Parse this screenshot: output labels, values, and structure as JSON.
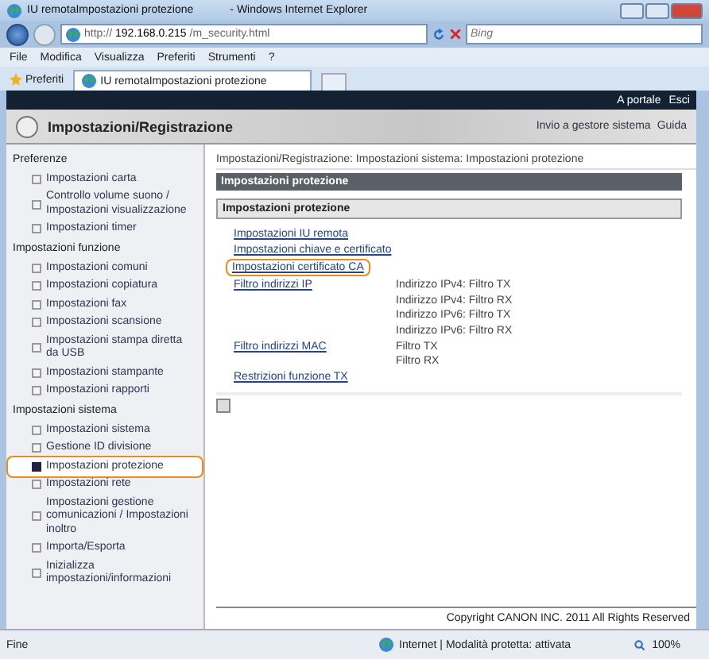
{
  "browser": {
    "title": "IU remotaImpostazioni protezione",
    "title_suffix": "- Windows Internet Explorer",
    "url_scheme": "http://",
    "url_host": "192.168.0.215",
    "url_path": "/m_security.html",
    "search_placeholder": "Bing",
    "menu": [
      "File",
      "Modifica",
      "Visualizza",
      "Preferiti",
      "Strumenti",
      "?"
    ],
    "favorites": "Preferiti",
    "tab": "IU remotaImpostazioni protezione"
  },
  "header": {
    "links": [
      "A portale",
      "Esci"
    ],
    "title": "Impostazioni/Registrazione",
    "nav_links": [
      "Invio a gestore sistema",
      "Guida"
    ]
  },
  "sidebar": [
    {
      "label": "Preferenze",
      "items": [
        {
          "label": "Impostazioni carta",
          "selected": false,
          "highlighted": false
        },
        {
          "label": "Controllo volume suono / Impostazioni visualizzazione",
          "selected": false,
          "highlighted": false
        },
        {
          "label": "Impostazioni timer",
          "selected": false,
          "highlighted": false
        }
      ]
    },
    {
      "label": "Impostazioni funzione",
      "items": [
        {
          "label": "Impostazioni comuni",
          "selected": false,
          "highlighted": false
        },
        {
          "label": "Impostazioni copiatura",
          "selected": false,
          "highlighted": false
        },
        {
          "label": "Impostazioni fax",
          "selected": false,
          "highlighted": false
        },
        {
          "label": "Impostazioni scansione",
          "selected": false,
          "highlighted": false
        },
        {
          "label": "Impostazioni stampa diretta da USB",
          "selected": false,
          "highlighted": false
        },
        {
          "label": "Impostazioni stampante",
          "selected": false,
          "highlighted": false
        },
        {
          "label": "Impostazioni rapporti",
          "selected": false,
          "highlighted": false
        }
      ]
    },
    {
      "label": "Impostazioni sistema",
      "items": [
        {
          "label": "Impostazioni sistema",
          "selected": false,
          "highlighted": false
        },
        {
          "label": "Gestione ID divisione",
          "selected": false,
          "highlighted": false
        },
        {
          "label": "Impostazioni protezione",
          "selected": true,
          "highlighted": true
        },
        {
          "label": "Impostazioni rete",
          "selected": false,
          "highlighted": false
        },
        {
          "label": "Impostazioni gestione comunicazioni / Impostazioni inoltro",
          "selected": false,
          "highlighted": false
        },
        {
          "label": "Importa/Esporta",
          "selected": false,
          "highlighted": false
        },
        {
          "label": "Inizializza impostazioni/informazioni",
          "selected": false,
          "highlighted": false
        }
      ]
    }
  ],
  "content": {
    "breadcrumb": "Impostazioni/Registrazione: Impostazioni sistema: Impostazioni protezione",
    "page_title": "Impostazioni protezione",
    "section_title": "Impostazioni protezione",
    "rows": [
      {
        "link": "Impostazioni IU remota",
        "highlighted": false,
        "details": []
      },
      {
        "link": "Impostazioni chiave e certificato",
        "highlighted": false,
        "details": []
      },
      {
        "link": "Impostazioni certificato CA",
        "highlighted": true,
        "details": []
      },
      {
        "link": "Filtro indirizzi IP",
        "highlighted": false,
        "details": [
          "Indirizzo IPv4: Filtro TX",
          "Indirizzo IPv4: Filtro RX",
          "Indirizzo IPv6: Filtro TX",
          "Indirizzo IPv6: Filtro RX"
        ]
      },
      {
        "link": "Filtro indirizzi MAC",
        "highlighted": false,
        "details": [
          "Filtro TX",
          "Filtro RX"
        ]
      },
      {
        "link": "Restrizioni funzione TX",
        "highlighted": false,
        "details": []
      }
    ],
    "copyright": "Copyright CANON INC. 2011 All Rights Reserved"
  },
  "status_bar": {
    "text": "Fine",
    "zone": "Internet | Modalità protetta: attivata",
    "zoom": "100%"
  }
}
